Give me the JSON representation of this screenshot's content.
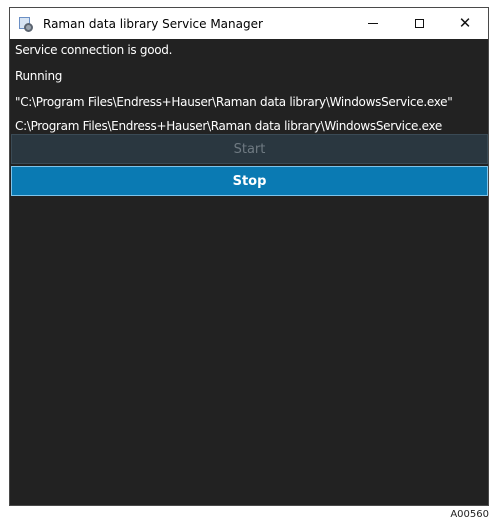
{
  "window": {
    "title": "Raman data library Service Manager",
    "controls": {
      "minimize": "minimize",
      "maximize": "maximize",
      "close": "✕"
    }
  },
  "status": {
    "connection": "Service connection is good.",
    "state": "Running",
    "command_path": "\"C:\\Program Files\\Endress+Hauser\\Raman data library\\WindowsService.exe\"",
    "exe_path": "C:\\Program Files\\Endress+Hauser\\Raman data library\\WindowsService.exe"
  },
  "actions": {
    "start_label": "Start",
    "stop_label": "Stop"
  },
  "figure_label": "A00560",
  "colors": {
    "window_bg": "#222222",
    "stop_button": "#0a7ab3",
    "start_button_disabled": "#2a3740"
  },
  "icons": {
    "app": "app-service-icon",
    "minimize": "minimize-icon",
    "maximize": "maximize-icon",
    "close": "close-icon"
  }
}
